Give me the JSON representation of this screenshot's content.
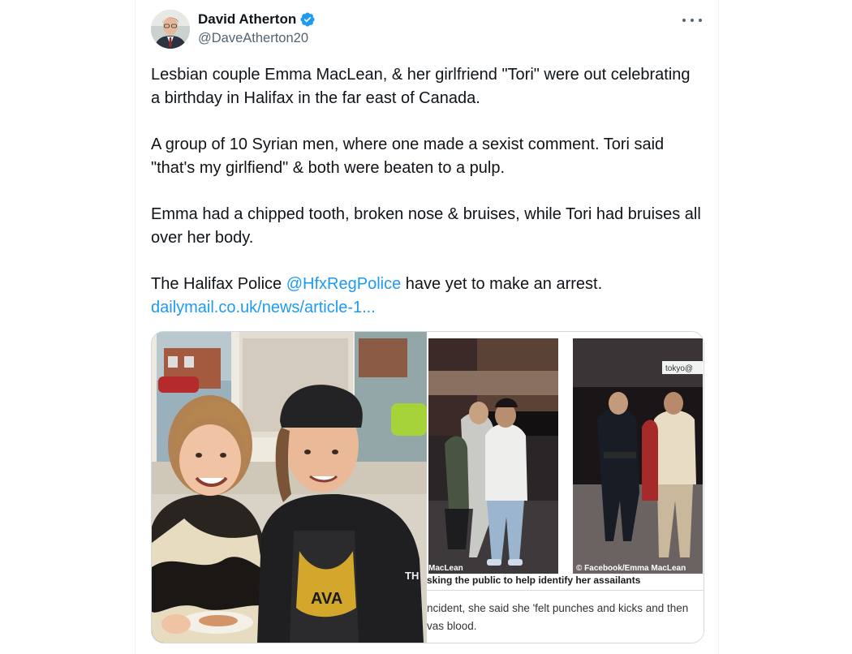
{
  "author": {
    "name": "David Atherton",
    "handle": "@DaveAtherton20",
    "verified": true
  },
  "tweet": {
    "para1": "Lesbian couple Emma MacLean, & her girlfriend \"Tori\" were out celebrating a birthday in Halifax in the far east of Canada.",
    "para2": "A group of 10 Syrian men, where one made a sexist comment. Tori said \"that's my girlfiend\" & both were beaten to a pulp.",
    "para3": "Emma had a chipped tooth, broken nose & bruises, while Tori had bruises all over her body.",
    "para4_before": "The Halifax Police ",
    "mention": "@HfxRegPolice",
    "para4_after": " have yet to make an arrest.",
    "link": "dailymail.co.uk/news/article-1..."
  },
  "media": {
    "credit_left": "MacLean",
    "credit_right": "© Facebook/Emma MacLean",
    "sign_text": "tokyo@",
    "shirt_text": "TH",
    "caption": "sking the public to help identify her assailants",
    "body_line1": "ncident, she said she 'felt punches and kicks and then",
    "body_line2": "vas blood."
  },
  "colors": {
    "link": "#1d9bf0",
    "verified": "#1d9bf0",
    "text": "#0f1419",
    "muted": "#536471"
  }
}
